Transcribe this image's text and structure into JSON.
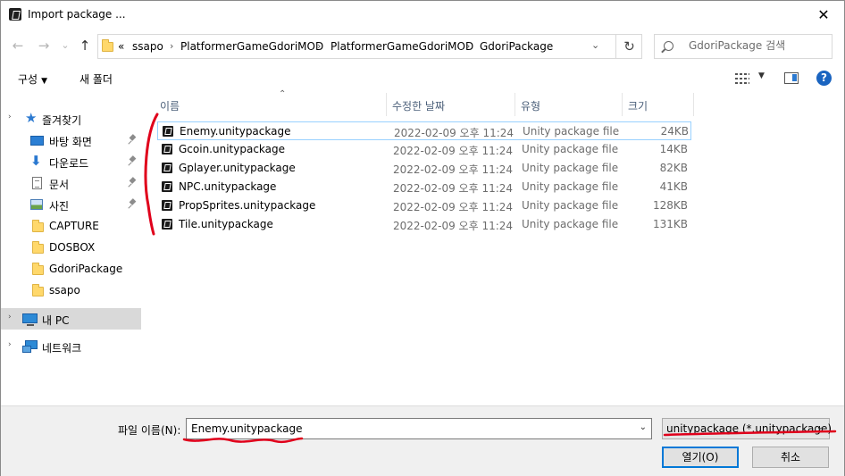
{
  "window": {
    "title": "Import package ...",
    "close_glyph": "✕"
  },
  "address": {
    "overflow": "«",
    "crumbs": [
      "ssapo",
      "PlatformerGameGdoriMOD",
      "PlatformerGameGdoriMOD",
      "GdoriPackage"
    ],
    "separator": "›",
    "refresh_glyph": "↻"
  },
  "nav_buttons": {
    "back": "←",
    "forward": "→",
    "history": "⌄",
    "up": "↑"
  },
  "search": {
    "placeholder": "GdoriPackage 검색"
  },
  "toolbar": {
    "organize": "구성",
    "new_folder": "새 폴더",
    "help": "?"
  },
  "navpane": {
    "quick_access": "즐겨찾기",
    "items": [
      "바탕 화면",
      "다운로드",
      "문서",
      "사진",
      "CAPTURE",
      "DOSBOX",
      "GdoriPackage",
      "ssapo"
    ],
    "this_pc": "내 PC",
    "network": "네트워크"
  },
  "columns": {
    "name": "이름",
    "date": "수정한 날짜",
    "type": "유형",
    "size": "크기"
  },
  "files": [
    {
      "name": "Enemy.unitypackage",
      "date": "2022-02-09 오후 11:24",
      "type": "Unity package file",
      "size": "24KB"
    },
    {
      "name": "Gcoin.unitypackage",
      "date": "2022-02-09 오후 11:24",
      "type": "Unity package file",
      "size": "14KB"
    },
    {
      "name": "Gplayer.unitypackage",
      "date": "2022-02-09 오후 11:24",
      "type": "Unity package file",
      "size": "82KB"
    },
    {
      "name": "NPC.unitypackage",
      "date": "2022-02-09 오후 11:24",
      "type": "Unity package file",
      "size": "41KB"
    },
    {
      "name": "PropSprites.unitypackage",
      "date": "2022-02-09 오후 11:24",
      "type": "Unity package file",
      "size": "128KB"
    },
    {
      "name": "Tile.unitypackage",
      "date": "2022-02-09 오후 11:24",
      "type": "Unity package file",
      "size": "131KB"
    }
  ],
  "bottom": {
    "filename_label": "파일 이름(N):",
    "filename_value": "Enemy.unitypackage",
    "filetype": "unitypackage (*.unitypackage)",
    "open": "열기(O)",
    "cancel": "취소"
  },
  "colors": {
    "accent": "#0078d7",
    "selection_border": "#99d1ff",
    "annotation_red": "#e0001b"
  }
}
